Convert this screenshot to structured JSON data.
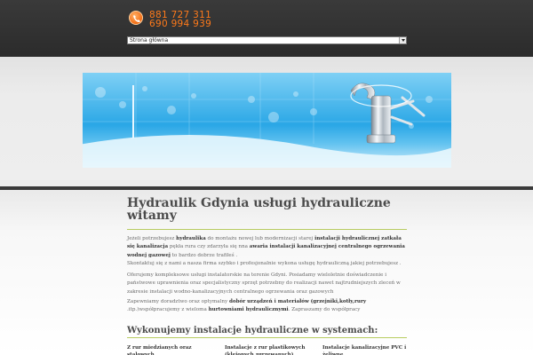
{
  "header": {
    "phone_1": "881 727 311",
    "phone_2": "690 994 939",
    "menu_selected": "Strona główna"
  },
  "main": {
    "title": "Hydraulik Gdynia usługi hydrauliczne witamy",
    "p1": [
      "Jeżeli potrzebujesz ",
      "hydraulika",
      " do montażu nowej lub modernizacji starej ",
      "instalacji hydraulicznej zatkała się kanalizacja",
      " pękła rura czy zdarzyła się nna ",
      "awaria instalacji kanalizacyjnej centralnego ogrzewania wodnej gazowej",
      " to bardzo dobrze trafiłeś .",
      "Skontaktuj się z nami a nasza firma szybko i profesjonalnie wykona usługę hydrauliczną jakiej potrzebujesz ."
    ],
    "p2": "Oferujemy kompleksowe usługi instalatorskie na terenie Gdyni. Posiadamy wieloletnie doświadczenie i państwowe uprawnienia oraz specjalistyczny sprzęt potrzebny do realizacji nawet najtrudniejszych zleceń w zakresie instalacji wodno-kanalizacyjnych centralnego ogrzewania oraz gazowych",
    "p3": [
      "Zapewniamy doradztwo oraz optymalny ",
      "dobór urządzeń i materiałów",
      " ",
      "(grzejniki,kotły,rury",
      " .itp.)współpracujemy z wieloma ",
      "hurtowniami hydraulicznymi",
      ". Zapraszamy do współpracy"
    ],
    "systems_heading": "Wykonujemy instalacje hydrauliczne w systemach:",
    "columns": [
      "Z rur miedzianych oraz stalowych",
      "Instalacje z rur plastikowych (klejonych zgrzewanych)",
      "Instalacje kanalizacyjne PVC i żeliwne"
    ]
  },
  "colors": {
    "accent": "#ff7a1a",
    "underline": "#b8cc60",
    "header_bg": "#2f2f2f"
  },
  "icons": [
    "phone-icon",
    "faucet-image"
  ]
}
